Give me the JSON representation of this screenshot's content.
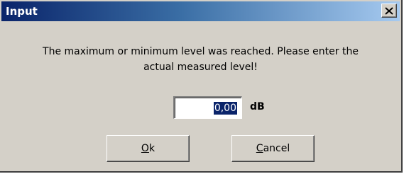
{
  "window": {
    "title": "Input",
    "close_glyph": "×",
    "icons": {
      "close": "close-icon"
    }
  },
  "message": {
    "line1": "The maximum or minimum level was reached. Please enter the",
    "line2": "actual measured level!"
  },
  "level": {
    "value": "0,00",
    "unit": "dB"
  },
  "buttons": {
    "ok": {
      "accel": "O",
      "rest": "k"
    },
    "cancel": {
      "accel": "C",
      "rest": "ancel"
    }
  },
  "colors": {
    "titlebar_start": "#0a246a",
    "titlebar_end": "#a6caf0",
    "dialog_bg": "#d4d0c8",
    "selection_bg": "#0a246a"
  }
}
